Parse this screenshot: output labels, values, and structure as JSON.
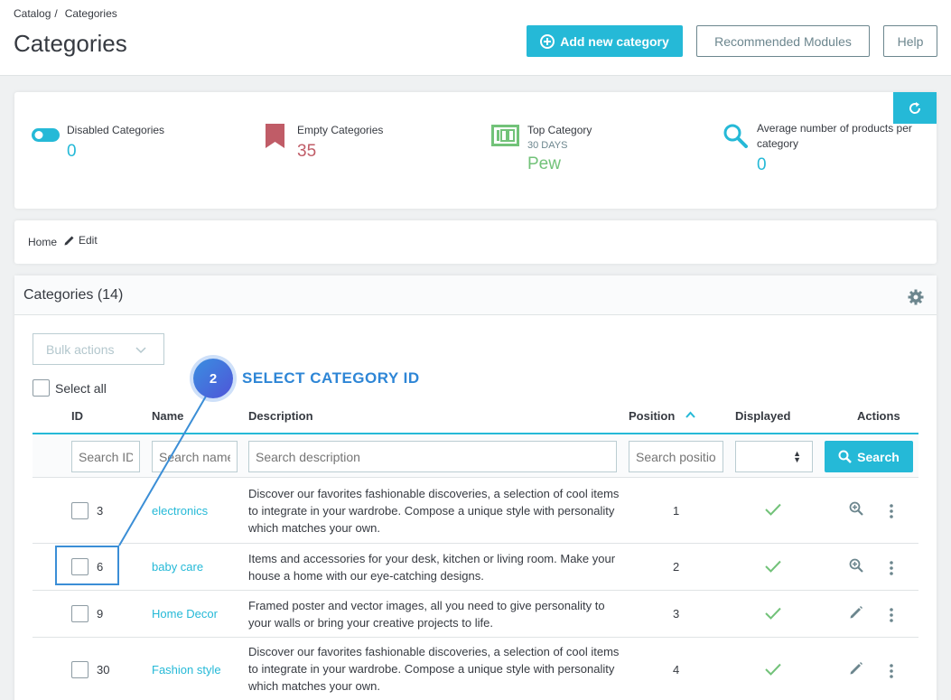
{
  "header": {
    "breadcrumb": [
      "Catalog",
      "/",
      "Categories"
    ],
    "title": "Categories",
    "add_label": "Add new category",
    "recommended_label": "Recommended Modules",
    "help_label": "Help"
  },
  "kpis": [
    {
      "label": "Disabled Categories",
      "value": "0",
      "icon": "toggle-icon",
      "color": "#25b9d7"
    },
    {
      "label": "Empty Categories",
      "value": "35",
      "icon": "bookmark-icon",
      "color": "#c05c67"
    },
    {
      "label": "Top Category",
      "sub": "30 DAYS",
      "value": "Pew",
      "icon": "badge-icon",
      "color": "#72c279"
    },
    {
      "label": "Average number of products per category",
      "value": "0",
      "icon": "search-icon",
      "color": "#25b9d7"
    }
  ],
  "breadcrumb_card": {
    "home": "Home",
    "edit": "Edit"
  },
  "table": {
    "title": "Categories (14)",
    "bulk_label": "Bulk actions",
    "select_all": "Select all",
    "columns": {
      "id": "ID",
      "name": "Name",
      "description": "Description",
      "position": "Position",
      "displayed": "Displayed",
      "actions": "Actions"
    },
    "filters": {
      "id_placeholder": "Search ID",
      "name_placeholder": "Search name",
      "desc_placeholder": "Search description",
      "pos_placeholder": "Search position",
      "search_label": "Search"
    },
    "rows": [
      {
        "id": "3",
        "name": "electronics",
        "description": "Discover our favorites fashionable discoveries, a selection of cool items to integrate in your wardrobe. Compose a unique style with personality which matches your own.",
        "position": "1",
        "action": "zoom-icon"
      },
      {
        "id": "6",
        "name": "baby care",
        "description": "Items and accessories for your desk, kitchen or living room. Make your house a home with our eye-catching designs.",
        "position": "2",
        "action": "zoom-icon"
      },
      {
        "id": "9",
        "name": "Home Decor",
        "description": "Framed poster and vector images, all you need to give personality to your walls or bring your creative projects to life.",
        "position": "3",
        "action": "pencil-icon"
      },
      {
        "id": "30",
        "name": "Fashion style",
        "description": "Discover our favorites fashionable discoveries, a selection of cool items to integrate in your wardrobe. Compose a unique style with personality which matches your own.",
        "position": "4",
        "action": "pencil-icon"
      }
    ]
  },
  "annotation": {
    "step": "2",
    "text": "SELECT CATEGORY ID"
  }
}
